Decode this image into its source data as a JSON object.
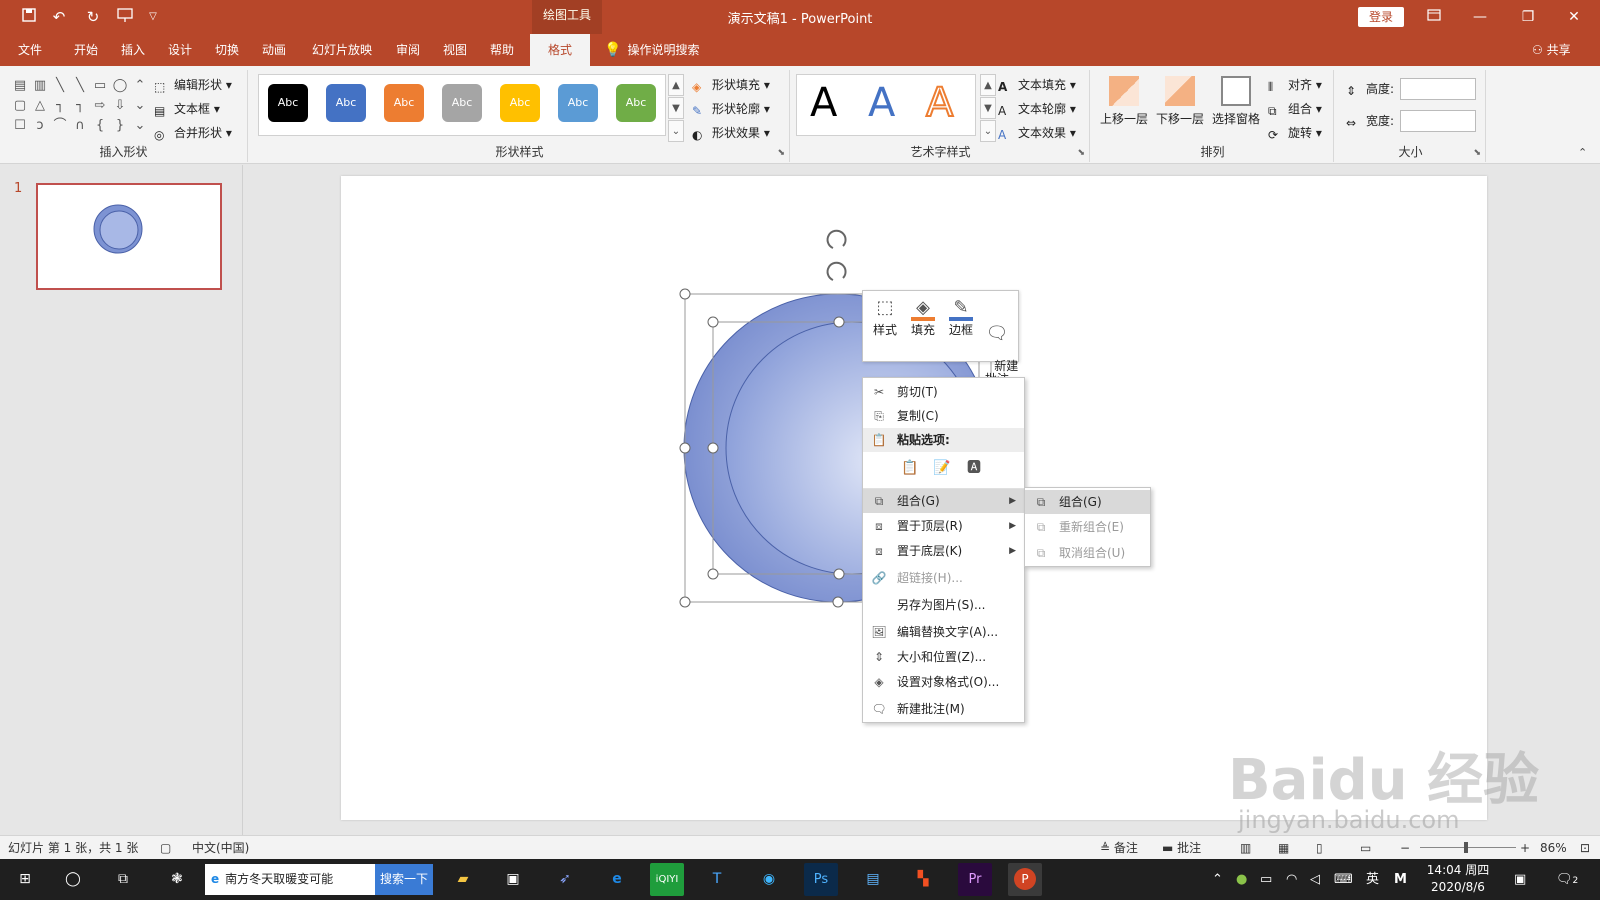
{
  "titlebar": {
    "tool_context": "绘图工具",
    "doc_title": "演示文稿1  -  PowerPoint",
    "login": "登录",
    "quick_access": [
      "save-icon",
      "undo-icon",
      "redo-icon",
      "present-icon",
      "customize-icon"
    ]
  },
  "tabs": [
    "文件",
    "开始",
    "插入",
    "设计",
    "切换",
    "动画",
    "幻灯片放映",
    "审阅",
    "视图",
    "帮助",
    "格式"
  ],
  "active_tab": "格式",
  "tell_me": "操作说明搜索",
  "share": "共享",
  "ribbon": {
    "insert_shapes": {
      "label": "插入形状",
      "edit_shape": "编辑形状",
      "text_box": "文本框",
      "merge_shapes": "合并形状"
    },
    "shape_styles": {
      "label": "形状样式",
      "swatches": [
        {
          "text": "Abc",
          "color": "#000000"
        },
        {
          "text": "Abc",
          "color": "#4472c4"
        },
        {
          "text": "Abc",
          "color": "#ed7d31"
        },
        {
          "text": "Abc",
          "color": "#a5a5a5"
        },
        {
          "text": "Abc",
          "color": "#ffc000"
        },
        {
          "text": "Abc",
          "color": "#5b9bd5"
        },
        {
          "text": "Abc",
          "color": "#70ad47"
        }
      ],
      "fill": "形状填充",
      "outline": "形状轮廓",
      "effects": "形状效果"
    },
    "wordart": {
      "label": "艺术字样式",
      "samples": [
        {
          "text": "A",
          "color": "#000000"
        },
        {
          "text": "A",
          "color": "#4472c4"
        },
        {
          "text": "A",
          "color": "#ed7d31"
        }
      ],
      "text_fill": "文本填充",
      "text_outline": "文本轮廓",
      "text_effects": "文本效果"
    },
    "arrange": {
      "label": "排列",
      "bring_forward": "上移一层",
      "send_backward": "下移一层",
      "selection_pane": "选择窗格",
      "align": "对齐",
      "group": "组合",
      "rotate": "旋转"
    },
    "size": {
      "label": "大小",
      "height": "高度:",
      "width": "宽度:",
      "height_value": "",
      "width_value": ""
    }
  },
  "thumbnails": {
    "slide_number": "1"
  },
  "mini_toolbar": {
    "style": "样式",
    "fill": "填充",
    "border": "边框",
    "new_comment": "新建\n批注"
  },
  "context_menu": {
    "cut": "剪切(T)",
    "copy": "复制(C)",
    "paste_options": "粘贴选项:",
    "group": "组合(G)",
    "bring_to_front": "置于顶层(R)",
    "send_to_back": "置于底层(K)",
    "hyperlink": "超链接(H)...",
    "save_as_picture": "另存为图片(S)...",
    "edit_alt_text": "编辑替换文字(A)...",
    "size_position": "大小和位置(Z)...",
    "format_object": "设置对象格式(O)...",
    "new_comment": "新建批注(M)"
  },
  "submenu": {
    "group": "组合(G)",
    "regroup": "重新组合(E)",
    "ungroup": "取消组合(U)"
  },
  "statusbar": {
    "slide_info": "幻灯片 第 1 张，共 1 张",
    "language": "中文(中国)",
    "notes": "备注",
    "comments": "批注",
    "zoom": "86%"
  },
  "taskbar": {
    "search_text": "南方冬天取暖变可能",
    "search_button": "搜索一下",
    "ime": "英",
    "ime_mode": "M",
    "time": "14:04 周四",
    "date": "2020/8/6",
    "notification_count": "2"
  },
  "watermark": {
    "text": "Baidu 经验",
    "url": "jingyan.baidu.com"
  },
  "colors": {
    "accent": "#b7472a",
    "shape_fill": "#8fa3d9",
    "shape_stroke": "#4a61a8"
  }
}
